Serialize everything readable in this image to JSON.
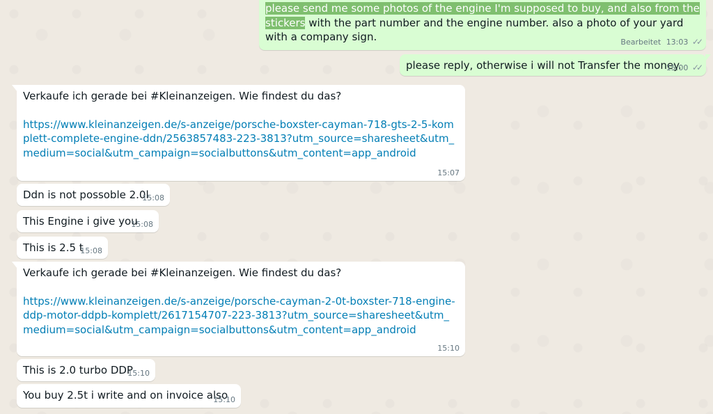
{
  "messages": [
    {
      "highlight": "please send me some photos of the engine I'm supposed to buy, and also from the stickers",
      "rest": " with the part number and the engine number. also a photo of your yard with a company sign.",
      "edited": "Bearbeitet",
      "time": "13:03",
      "tick": "✓✓"
    },
    {
      "text": "please reply, otherwise i will not Transfer the money.",
      "time": "15:00",
      "tick": "✓✓"
    },
    {
      "text": "Verkaufe ich gerade bei #Kleinanzeigen. Wie findest du das?",
      "link": "https://www.kleinanzeigen.de/s-anzeige/porsche-boxster-cayman-718-gts-2-5-komplett-complete-engine-ddn/2563857483-223-3813?utm_source=sharesheet&utm_medium=social&utm_campaign=socialbuttons&utm_content=app_android",
      "time": "15:07"
    },
    {
      "text": "Ddn is not possoble 2.0l",
      "time": "15:08"
    },
    {
      "text": "This Engine i give you",
      "time": "15:08"
    },
    {
      "text": "This is 2.5 t",
      "time": "15:08"
    },
    {
      "text": "Verkaufe ich gerade bei #Kleinanzeigen. Wie findest du das?",
      "link": "https://www.kleinanzeigen.de/s-anzeige/porsche-cayman-2-0t-boxster-718-engine-ddp-motor-ddpb-komplett/2617154707-223-3813?utm_source=sharesheet&utm_medium=social&utm_campaign=socialbuttons&utm_content=app_android",
      "time": "15:10"
    },
    {
      "text": "This is 2.0 turbo DDP",
      "time": "15:10"
    },
    {
      "text": "You buy 2.5t i write and on invoice also",
      "time": "15:10"
    }
  ],
  "colors": {
    "background": "#efeae2",
    "outgoing": "#d9fdd3",
    "incoming": "#ffffff",
    "link": "#027eb5",
    "highlight": "#7fbf6f"
  }
}
